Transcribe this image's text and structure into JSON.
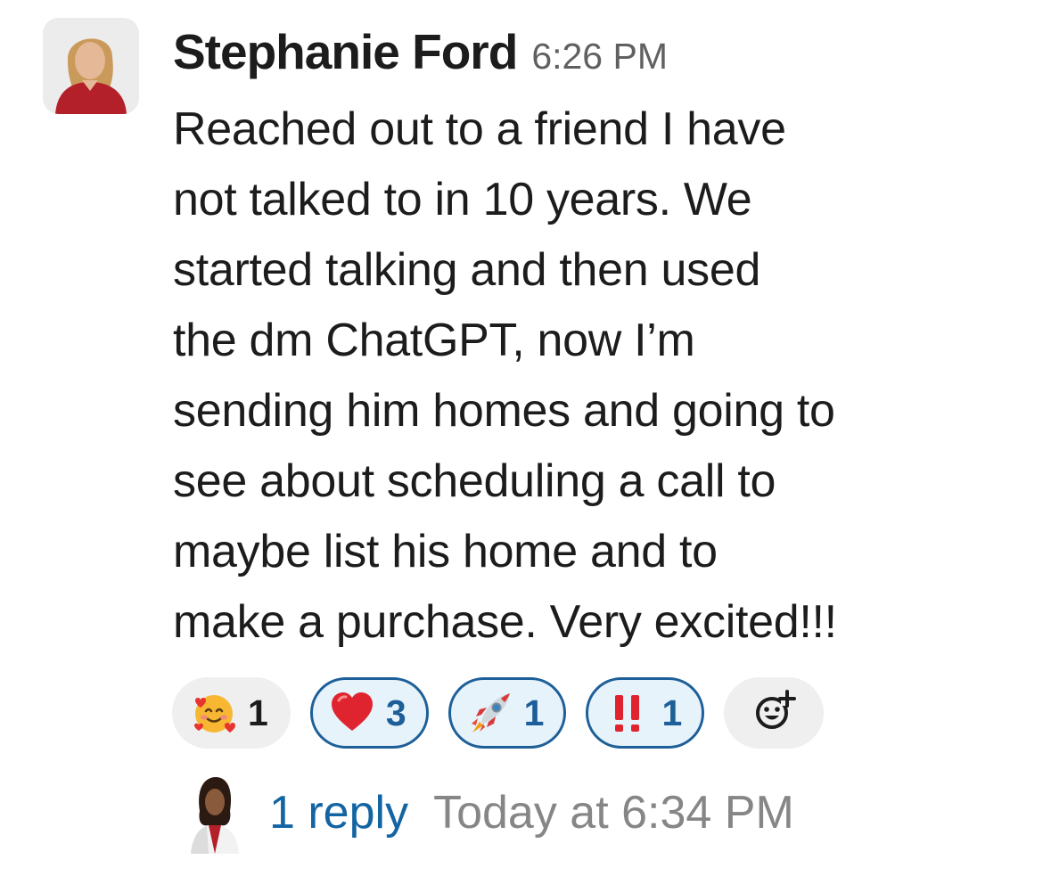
{
  "message": {
    "sender": "Stephanie Ford",
    "time": "6:26 PM",
    "text": "Reached out to a friend I have\nnot talked to in 10 years. We\nstarted talking and then used\nthe dm ChatGPT, now I’m\nsending him homes and going to\nsee about scheduling a call to\nmaybe list his home and to\nmake a purchase. Very excited!!!"
  },
  "reactions": [
    {
      "emoji": "smiling-face-with-hearts",
      "count": "1",
      "active": false
    },
    {
      "emoji": "red-heart",
      "count": "3",
      "active": true
    },
    {
      "emoji": "rocket",
      "count": "1",
      "active": true
    },
    {
      "emoji": "double-exclamation",
      "count": "1",
      "active": true
    }
  ],
  "add_reaction_icon": "add-reaction-icon",
  "thread": {
    "reply_count": "1 reply",
    "last_reply": "Today at 6:34 PM"
  },
  "colors": {
    "link": "#1264a3",
    "reaction_active_border": "#1d5f98",
    "reaction_active_bg": "#e7f3fb",
    "reaction_bg": "#efefef",
    "muted": "#616061"
  }
}
